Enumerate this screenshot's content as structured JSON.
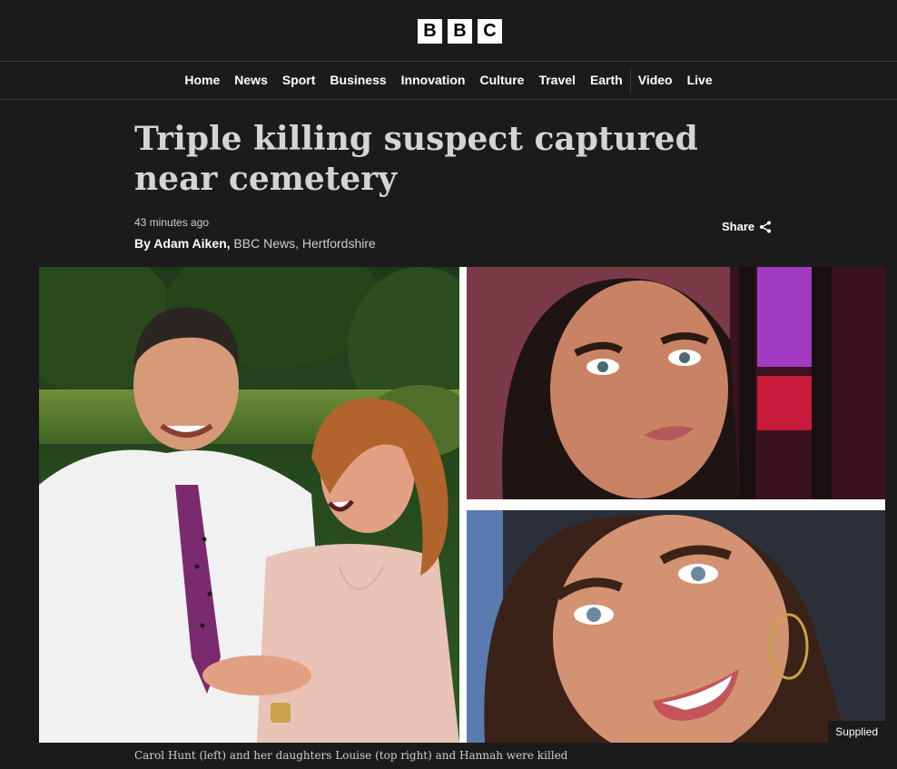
{
  "header": {
    "logo_letters": [
      "B",
      "B",
      "C"
    ]
  },
  "nav": {
    "items": [
      {
        "label": "Home"
      },
      {
        "label": "News"
      },
      {
        "label": "Sport"
      },
      {
        "label": "Business"
      },
      {
        "label": "Innovation"
      },
      {
        "label": "Culture"
      },
      {
        "label": "Travel"
      },
      {
        "label": "Earth"
      },
      {
        "label": "Video"
      },
      {
        "label": "Live"
      }
    ]
  },
  "article": {
    "headline": "Triple killing suspect captured near cemetery",
    "timestamp": "43 minutes ago",
    "byline_prefix": "By Adam Aiken,",
    "byline_org": " BBC News, Hertfordshire",
    "share_label": "Share",
    "share_icon": "share-icon",
    "image_credit": "Supplied",
    "caption": "Carol Hunt (left) and her daughters Louise (top right) and Hannah were killed"
  },
  "colors": {
    "background": "#1b1b1b",
    "headline": "#d4d4d4",
    "text_muted": "#cfcfcf",
    "divider": "#3a3a3a"
  }
}
